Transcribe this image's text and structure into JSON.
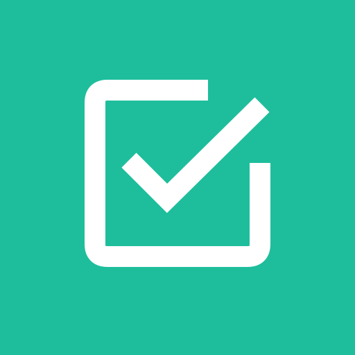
{
  "icon": {
    "name": "checkbox-checked-icon",
    "background_color": "#1ebe9c",
    "foreground_color": "#ffffff"
  }
}
